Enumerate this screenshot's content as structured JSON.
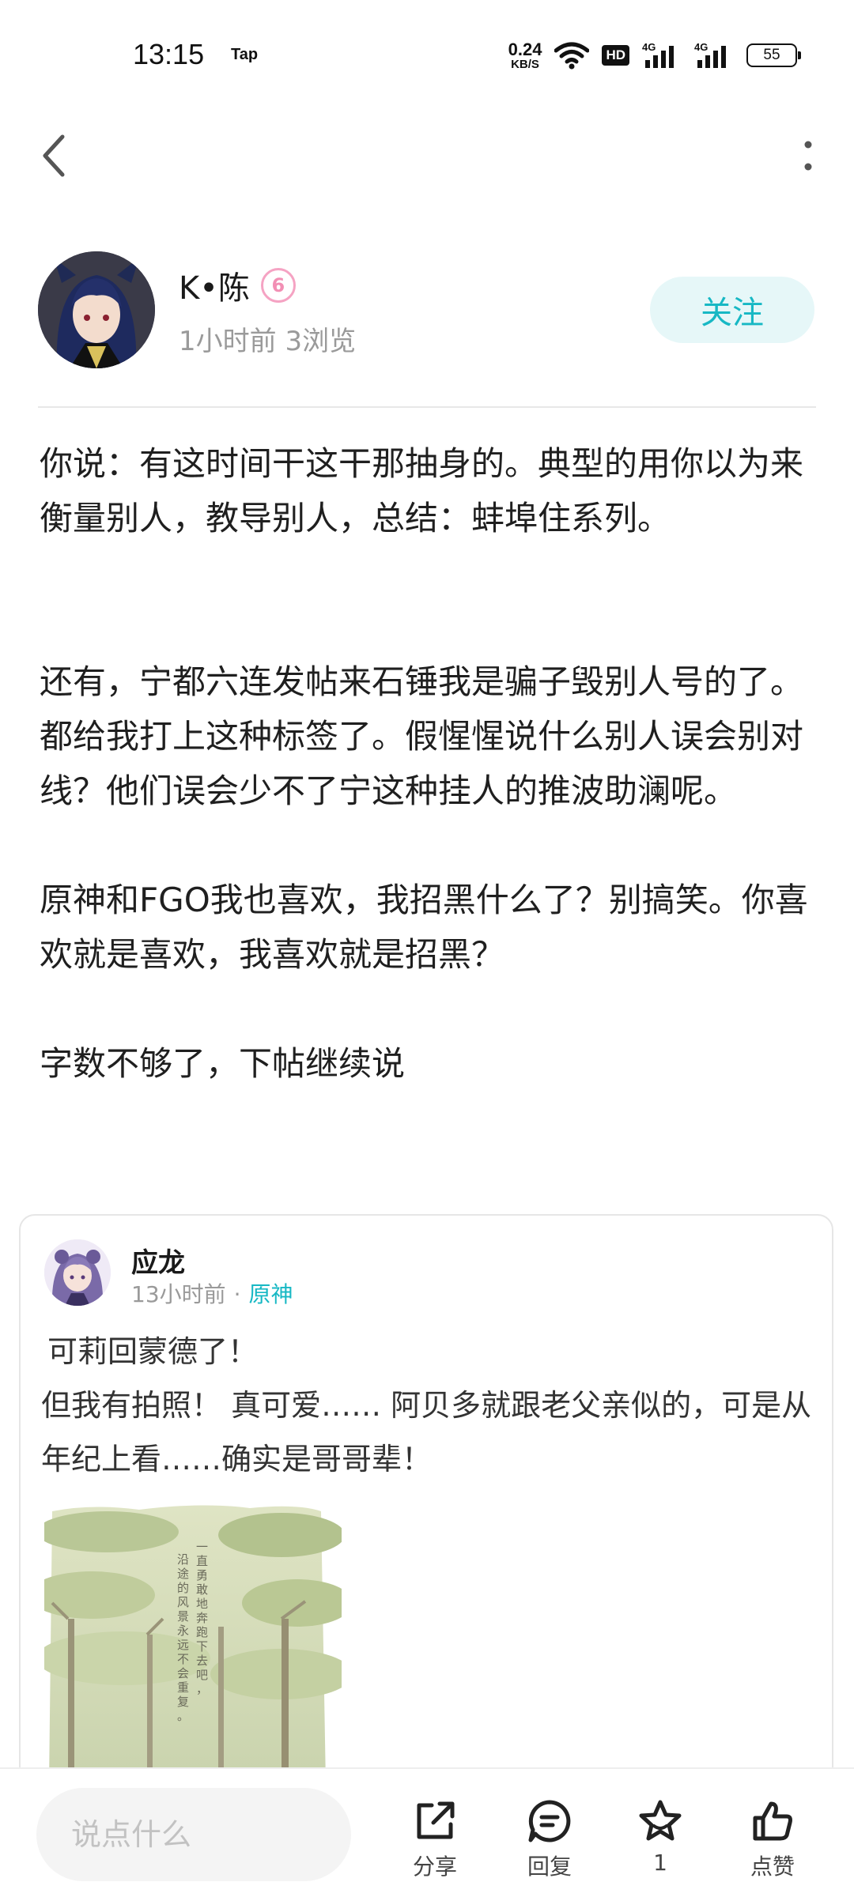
{
  "status_bar": {
    "time": "13:15",
    "carrier_app": "Tap",
    "net_speed_value": "0.24",
    "net_speed_unit": "KB/S",
    "hd_label": "HD",
    "battery": "55"
  },
  "author": {
    "name": "K•陈",
    "level": "6",
    "meta": "1小时前  3浏览",
    "follow_label": "关注"
  },
  "post": {
    "paragraphs": [
      "你说：有这时间干这干那抽身的。典型的用你以为来衡量别人，教导别人，总结：蚌埠住系列。",
      "",
      "还有，宁都六连发帖来石锤我是骗子毁别人号的了。都给我打上这种标签了。假惺惺说什么别人误会别对线？他们误会少不了宁这种挂人的推波助澜呢。",
      "原神和FGO我也喜欢，我招黑什么了？别搞笑。你喜欢就是喜欢，我喜欢就是招黑？",
      "字数不够了，下帖继续说"
    ]
  },
  "quote": {
    "name": "应龙",
    "time": "13小时前",
    "dot": "·",
    "tag": "原神",
    "line1": "可莉回蒙德了！",
    "line2": "但我有拍照！  真可爱…… 阿贝多就跟老父亲似的，可是从年纪上看……确实是哥哥辈！"
  },
  "bottom_bar": {
    "input_placeholder": "说点什么",
    "share_label": "分享",
    "reply_label": "回复",
    "favorite_count": "1",
    "like_label": "点赞"
  },
  "colors": {
    "accent": "#17b8c4",
    "follow_bg": "#e6f7f8",
    "level_badge": "#f28fb4"
  },
  "icons": {
    "back": "back-arrow-icon",
    "more": "more-vertical-icon",
    "share": "share-icon",
    "reply": "comment-icon",
    "favorite": "star-icon",
    "like": "thumbs-up-icon"
  }
}
